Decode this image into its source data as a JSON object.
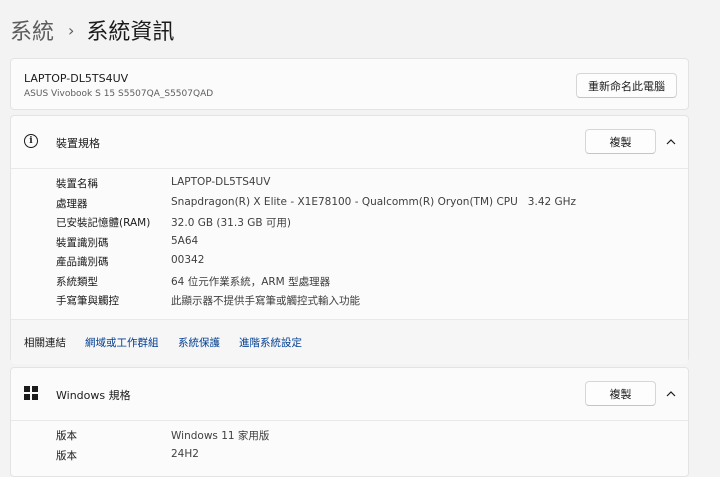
{
  "breadcrumb": {
    "parent": "系統",
    "current": "系統資訊"
  },
  "device": {
    "name": "LAPTOP-DL5TS4UV",
    "model": "ASUS Vivobook S 15 S5507QA_S5507QAD",
    "rename_label": "重新命名此電腦"
  },
  "device_specs": {
    "title": "裝置規格",
    "copy_label": "複製",
    "icon": "info-icon",
    "rows": [
      {
        "label": "裝置名稱",
        "value": "LAPTOP-DL5TS4UV"
      },
      {
        "label": "處理器",
        "value": "Snapdragon(R) X Elite - X1E78100 - Qualcomm(R) Oryon(TM) CPU   3.42 GHz"
      },
      {
        "label": "已安裝記憶體(RAM)",
        "value": "32.0 GB (31.3 GB 可用)"
      },
      {
        "label": "裝置識別碼",
        "value": "5A64"
      },
      {
        "label": "產品識別碼",
        "value": "00342"
      },
      {
        "label": "系統類型",
        "value": "64 位元作業系統，ARM 型處理器"
      },
      {
        "label": "手寫筆與觸控",
        "value": "此顯示器不提供手寫筆或觸控式輸入功能"
      }
    ]
  },
  "related": {
    "label": "相關連結",
    "links": [
      "網域或工作群組",
      "系統保護",
      "進階系統設定"
    ]
  },
  "windows_specs": {
    "title": "Windows 規格",
    "copy_label": "複製",
    "icon": "windows-logo-icon",
    "rows": [
      {
        "label": "版本",
        "value": "Windows 11 家用版"
      },
      {
        "label": "版本",
        "value": "24H2"
      }
    ]
  },
  "colors": {
    "background": "#f3f3f3",
    "card": "#fbfbfb",
    "link": "#003e92"
  }
}
